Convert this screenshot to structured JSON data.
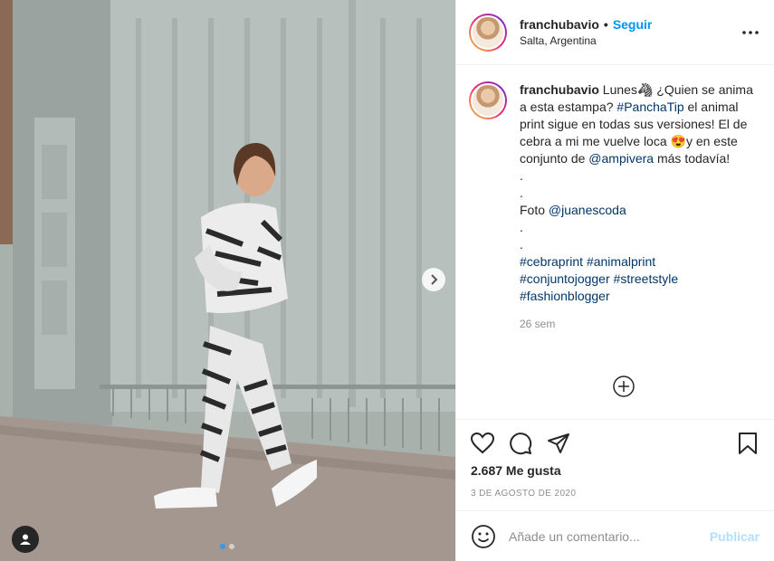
{
  "post": {
    "username": "franchubavio",
    "follow_label": "Seguir",
    "separator": "•",
    "location": "Salta, Argentina"
  },
  "caption": {
    "username": "franchubavio",
    "line1_text": " Lunes🦓 ¿Quien se anima a esta estampa? ",
    "hashtag_1": "#PanchaTip",
    "line2_text": " el animal print sigue en todas sus versiones! El de cebra a mi me vuelve loca 😍y en este conjunto de ",
    "mention_1": "@ampivera",
    "line3_text": " más todavía!",
    "dot_1": ".",
    "dot_2": ".",
    "photo_credit_text": "Foto ",
    "mention_2": "@juanescoda",
    "dot_3": ".",
    "dot_4": ".",
    "hashtags": [
      "#cebraprint",
      "#animalprint",
      "#conjuntojogger",
      "#streetstyle",
      "#fashionblogger"
    ],
    "time": "26 sem"
  },
  "actions": {
    "likes": "2.687 Me gusta",
    "date": "3 DE AGOSTO DE 2020"
  },
  "comment": {
    "placeholder": "Añade un comentario...",
    "post_label": "Publicar"
  },
  "icons": {
    "more": "more-options-icon",
    "next": "chevron-right-icon",
    "tag": "user-tag-icon",
    "like": "heart-icon",
    "comment": "comment-icon",
    "share": "share-icon",
    "save": "bookmark-icon",
    "emoji": "emoji-icon",
    "load_more": "plus-circle-icon"
  },
  "colors": {
    "follow": "#0095f6",
    "hashtag": "#00376b",
    "post_button": "#b2dffc",
    "carousel_active": "#3897f0"
  },
  "carousel": {
    "total_slides": 2,
    "active_slide": 1
  }
}
